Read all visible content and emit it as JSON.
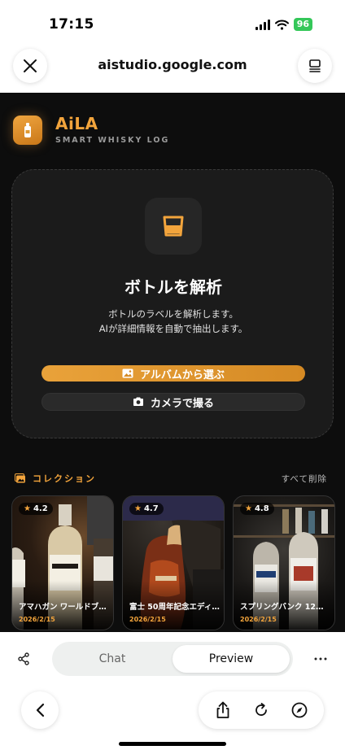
{
  "status_bar": {
    "time": "17:15",
    "battery": "96"
  },
  "browser": {
    "url": "aistudio.google.com"
  },
  "app": {
    "brand": "AiLA",
    "tagline": "SMART WHISKY LOG",
    "analyze_card": {
      "title": "ボトルを解析",
      "desc_line1": "ボトルのラベルを解析します。",
      "desc_line2": "AIが詳細情報を自動で抽出します。",
      "album_button": "アルバムから選ぶ",
      "camera_button": "カメラで撮る"
    },
    "collection": {
      "title": "コレクション",
      "clear_all": "すべて削除",
      "items": [
        {
          "rating": "4.2",
          "name": "アマハガン ワールドブ…",
          "date": "2026/2/15"
        },
        {
          "rating": "4.7",
          "name": "富士 50周年記念エディ…",
          "date": "2026/2/15"
        },
        {
          "rating": "4.8",
          "name": "スプリングバンク 12年 …",
          "date": "2026/2/15"
        }
      ]
    }
  },
  "bottom_tabs": {
    "chat": "Chat",
    "preview": "Preview"
  },
  "colors": {
    "accent": "#f2a43c",
    "app_bg": "#0d0d0d",
    "card_bg": "#1b1b1b"
  },
  "icons": [
    "close-icon",
    "tabs-icon",
    "glass-icon",
    "image-icon",
    "camera-icon",
    "share-icon",
    "more-icon",
    "back-icon",
    "upload-icon",
    "reload-icon",
    "compass-icon"
  ]
}
